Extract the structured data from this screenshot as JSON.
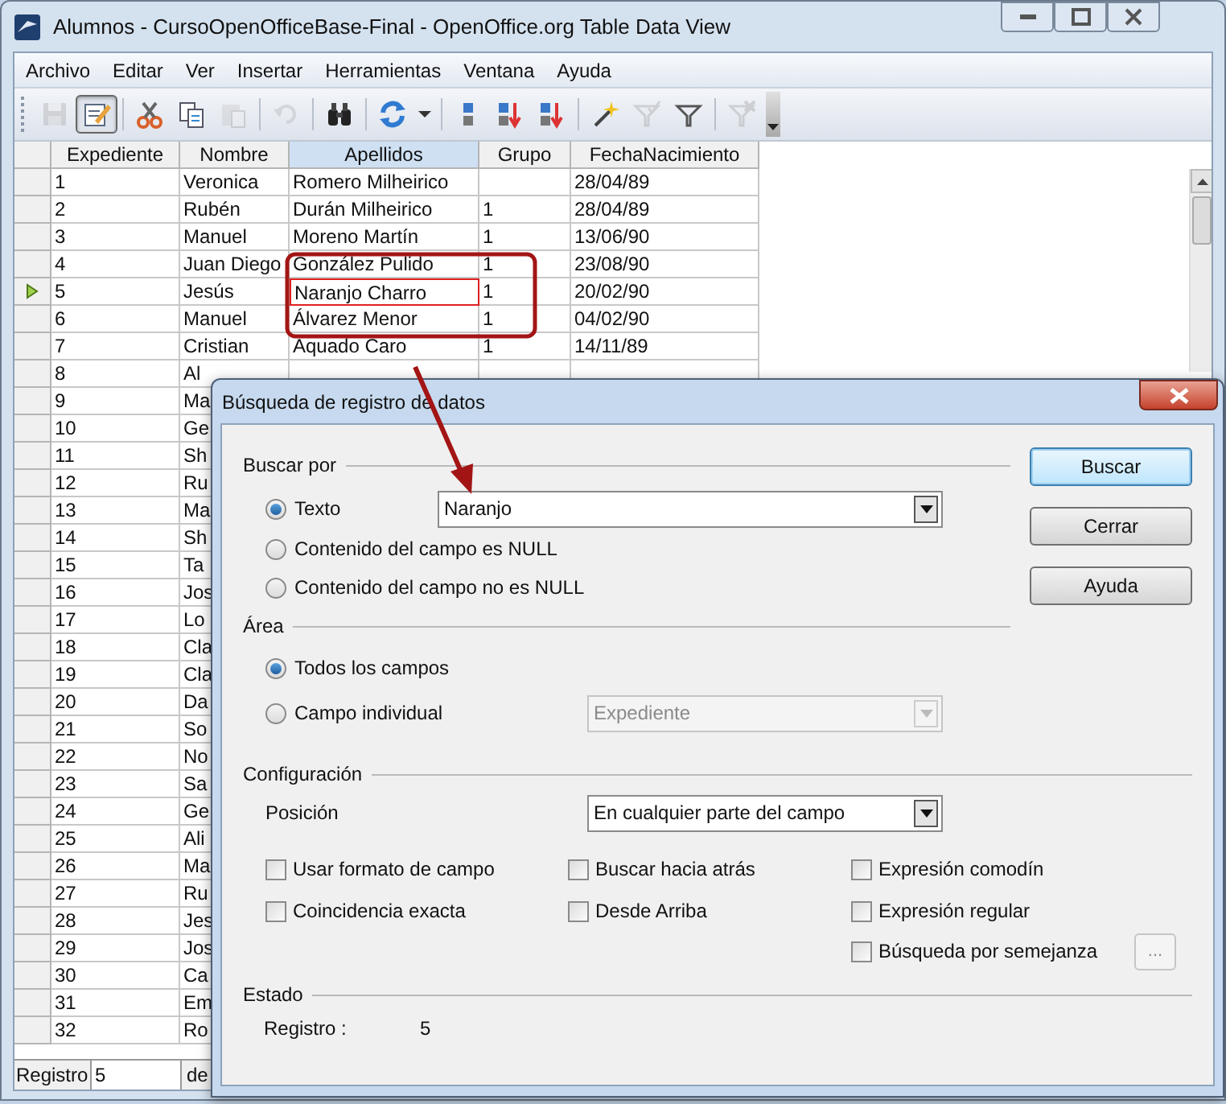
{
  "window": {
    "title": "Alumnos - CursoOpenOfficeBase-Final - OpenOffice.org Table Data View"
  },
  "menu": [
    "Archivo",
    "Editar",
    "Ver",
    "Insertar",
    "Herramientas",
    "Ventana",
    "Ayuda"
  ],
  "toolbar": [
    {
      "disabled": true,
      "pressed": false
    },
    {
      "disabled": false,
      "pressed": true
    },
    {
      "disabled": false,
      "pressed": false
    },
    {
      "disabled": false,
      "pressed": false
    },
    {
      "disabled": true,
      "pressed": false
    },
    {
      "disabled": true,
      "pressed": false
    },
    {
      "disabled": false,
      "pressed": false
    },
    {
      "disabled": false,
      "pressed": false
    },
    {
      "disabled": false,
      "pressed": false
    },
    {
      "disabled": false,
      "pressed": false
    },
    {
      "disabled": false,
      "pressed": false
    },
    {
      "disabled": false,
      "pressed": false
    },
    {
      "disabled": false,
      "pressed": false
    },
    {
      "disabled": true,
      "pressed": false
    },
    {
      "disabled": false,
      "pressed": false
    },
    {
      "disabled": true,
      "pressed": false
    }
  ],
  "table": {
    "columns": [
      {
        "label": "Expediente",
        "selected": false
      },
      {
        "label": "Nombre",
        "selected": false
      },
      {
        "label": "Apellidos",
        "selected": true
      },
      {
        "label": "Grupo",
        "selected": false
      },
      {
        "label": "FechaNacimiento",
        "selected": false
      }
    ],
    "rows": [
      {
        "current": false,
        "cells": [
          "1",
          "Veronica",
          "Romero Milheirico",
          "",
          "28/04/89"
        ]
      },
      {
        "current": false,
        "cells": [
          "2",
          "Rubén",
          "Durán Milheirico",
          "1",
          "28/04/89"
        ]
      },
      {
        "current": false,
        "cells": [
          "3",
          "Manuel",
          "Moreno Martín",
          "1",
          "13/06/90"
        ]
      },
      {
        "current": false,
        "cells": [
          "4",
          "Juan Diego",
          "González Pulido",
          "1",
          "23/08/90"
        ]
      },
      {
        "current": true,
        "cells": [
          "5",
          "Jesús",
          "Naranjo Charro",
          "1",
          "20/02/90"
        ]
      },
      {
        "current": false,
        "cells": [
          "6",
          "Manuel",
          "Álvarez Menor",
          "1",
          "04/02/90"
        ]
      },
      {
        "current": false,
        "cells": [
          "7",
          "Cristian",
          "Aquado Caro",
          "1",
          "14/11/89"
        ]
      },
      {
        "current": false,
        "cells": [
          "8",
          "Al"
        ]
      },
      {
        "current": false,
        "cells": [
          "9",
          "Ma"
        ]
      },
      {
        "current": false,
        "cells": [
          "10",
          "Ge"
        ]
      },
      {
        "current": false,
        "cells": [
          "11",
          "Sh"
        ]
      },
      {
        "current": false,
        "cells": [
          "12",
          "Ru"
        ]
      },
      {
        "current": false,
        "cells": [
          "13",
          "Ma"
        ]
      },
      {
        "current": false,
        "cells": [
          "14",
          "Sh"
        ]
      },
      {
        "current": false,
        "cells": [
          "15",
          "Ta"
        ]
      },
      {
        "current": false,
        "cells": [
          "16",
          "Jos"
        ]
      },
      {
        "current": false,
        "cells": [
          "17",
          "Lo"
        ]
      },
      {
        "current": false,
        "cells": [
          "18",
          "Cla"
        ]
      },
      {
        "current": false,
        "cells": [
          "19",
          "Cla"
        ]
      },
      {
        "current": false,
        "cells": [
          "20",
          "Da"
        ]
      },
      {
        "current": false,
        "cells": [
          "21",
          "So"
        ]
      },
      {
        "current": false,
        "cells": [
          "22",
          "No"
        ]
      },
      {
        "current": false,
        "cells": [
          "23",
          "Sa"
        ]
      },
      {
        "current": false,
        "cells": [
          "24",
          "Ge"
        ]
      },
      {
        "current": false,
        "cells": [
          "25",
          "Ali"
        ]
      },
      {
        "current": false,
        "cells": [
          "26",
          "Ma"
        ]
      },
      {
        "current": false,
        "cells": [
          "27",
          "Ru"
        ]
      },
      {
        "current": false,
        "cells": [
          "28",
          "Jes"
        ]
      },
      {
        "current": false,
        "cells": [
          "29",
          "Jos"
        ]
      },
      {
        "current": false,
        "cells": [
          "30",
          "Ca"
        ]
      },
      {
        "current": false,
        "cells": [
          "31",
          "Em"
        ]
      },
      {
        "current": false,
        "cells": [
          "32",
          "Ro"
        ]
      }
    ]
  },
  "status_bar": {
    "label": "Registro",
    "value": "5",
    "suffix": "de"
  },
  "dialog": {
    "title": "Búsqueda de registro de datos",
    "buscar_por": {
      "title": "Buscar por",
      "options": [
        {
          "label": "Texto",
          "selected": true
        },
        {
          "label": "Contenido del campo es NULL",
          "selected": false
        },
        {
          "label": "Contenido del campo no es NULL",
          "selected": false
        }
      ],
      "text_value": "Naranjo"
    },
    "area": {
      "title": "Área",
      "options": [
        {
          "label": "Todos los campos",
          "selected": true
        },
        {
          "label": "Campo individual",
          "selected": false
        }
      ],
      "field_value": "Expediente",
      "field_disabled": true
    },
    "configuracion": {
      "title": "Configuración",
      "position_label": "Posición",
      "position_value": "En cualquier parte del campo",
      "checkbox_columns": [
        [
          {
            "label": "Usar formato de campo",
            "checked": false
          },
          {
            "label": "Coincidencia exacta",
            "checked": false
          }
        ],
        [
          {
            "label": "Buscar hacia atrás",
            "checked": false
          },
          {
            "label": "Desde Arriba",
            "checked": false
          }
        ],
        [
          {
            "label": "Expresión comodín",
            "checked": false
          },
          {
            "label": "Expresión regular",
            "checked": false
          },
          {
            "label": "Búsqueda por semejanza",
            "checked": false
          }
        ]
      ],
      "similarity_button": "..."
    },
    "estado": {
      "title": "Estado",
      "label": "Registro :",
      "value": "5"
    },
    "buttons": [
      {
        "label": "Buscar",
        "default": true
      },
      {
        "label": "Cerrar",
        "default": false
      },
      {
        "label": "Ayuda",
        "default": false
      }
    ]
  }
}
